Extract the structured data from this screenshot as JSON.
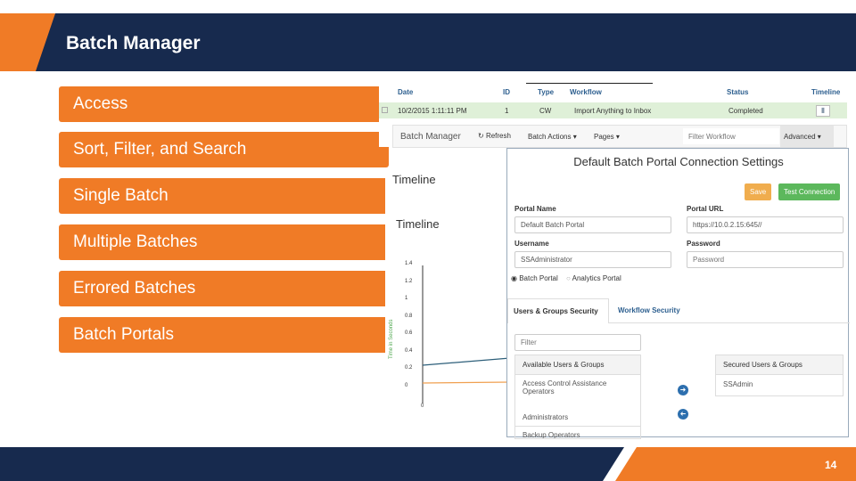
{
  "slide": {
    "title": "Batch Manager",
    "page_number": "14"
  },
  "topics": [
    "Access",
    "Sort, Filter, and Search",
    "Single Batch",
    "Multiple Batches",
    "Errored Batches",
    "Batch Portals"
  ],
  "table": {
    "headers": [
      "Date",
      "ID",
      "Type",
      "Workflow",
      "Status",
      "Timeline"
    ],
    "row": {
      "date": "10/2/2015 1:11:11 PM",
      "id": "1",
      "type": "CW",
      "workflow": "Import Anything to Inbox",
      "status": "Completed"
    }
  },
  "toolbar": {
    "title": "Batch Manager",
    "refresh": "Refresh",
    "batch_actions": "Batch Actions ▾",
    "pages": "Pages ▾",
    "filter_placeholder": "Filter Workflow",
    "advanced": "Advanced ▾"
  },
  "timeline": {
    "heading1": "Timeline",
    "heading2": "Timeline",
    "ylabel": "Time in Seconds",
    "yticks": [
      "1.4",
      "1.2",
      "1",
      "0.8",
      "0.6",
      "0.4",
      "0.2",
      "0"
    ],
    "xtick": "0"
  },
  "dialog": {
    "title": "Default Batch Portal Connection Settings",
    "save": "Save",
    "test": "Test Connection",
    "portal_name_label": "Portal Name",
    "portal_name": "Default Batch Portal",
    "portal_url_label": "Portal URL",
    "portal_url": "https://10.0.2.15:645//",
    "username_label": "Username",
    "username": "SSAdministrator",
    "password_label": "Password",
    "password_placeholder": "Password",
    "radio_batch": "Batch Portal",
    "radio_analytics": "Analytics Portal",
    "tab_users": "Users & Groups Security",
    "tab_workflow": "Workflow Security",
    "filter_placeholder": "Filter",
    "available_header": "Available Users & Groups",
    "available": [
      "Access Control Assistance Operators",
      "Administrators",
      "Backup Operators"
    ],
    "secured_header": "Secured Users & Groups",
    "secured": [
      "SSAdmin"
    ]
  },
  "colors": {
    "orange": "#f07b26",
    "navy": "#172a4e",
    "save": "#f0ad4e",
    "test": "#5cb85c"
  }
}
